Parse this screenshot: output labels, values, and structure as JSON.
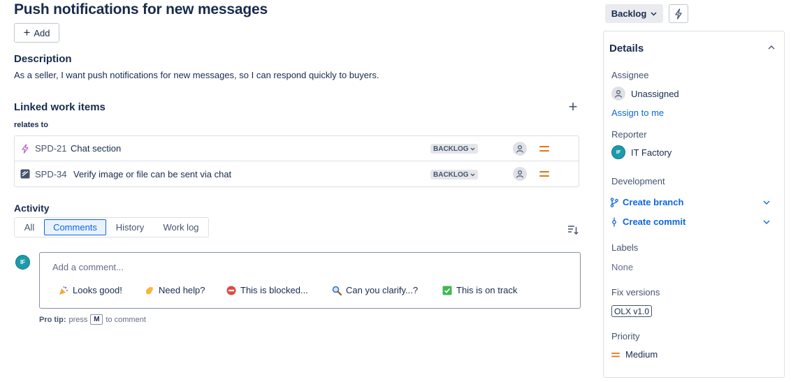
{
  "issue": {
    "title": "Push notifications for new messages",
    "add_label": "Add"
  },
  "description": {
    "heading": "Description",
    "text": "As a seller, I want push notifications for new messages, so I can respond quickly to buyers."
  },
  "linked": {
    "heading": "Linked work items",
    "relation": "relates to",
    "items": [
      {
        "key": "SPD-21",
        "summary": "Chat section",
        "status": "BACKLOG",
        "type_icon": "subtask-lightning-icon",
        "priority": "medium"
      },
      {
        "key": "SPD-34",
        "summary": "Verify image or file can be sent via chat",
        "status": "BACKLOG",
        "type_icon": "story-icon",
        "priority": "medium"
      }
    ]
  },
  "activity": {
    "heading": "Activity",
    "tabs": [
      "All",
      "Comments",
      "History",
      "Work log"
    ],
    "active_tab": "Comments",
    "avatar_initials": "IF",
    "comment_placeholder": "Add a comment...",
    "quick_replies": [
      {
        "emoji": "party-popper-icon",
        "label": "Looks good!"
      },
      {
        "emoji": "waving-hand-icon",
        "label": "Need help?"
      },
      {
        "emoji": "no-entry-icon",
        "label": "This is blocked..."
      },
      {
        "emoji": "magnifier-icon",
        "label": "Can you clarify...?"
      },
      {
        "emoji": "check-mark-icon",
        "label": "This is on track"
      }
    ],
    "pro_tip_label": "Pro tip:",
    "pro_tip_pre": "press",
    "pro_tip_key": "M",
    "pro_tip_post": "to comment"
  },
  "status_button": "Backlog",
  "details": {
    "heading": "Details",
    "assignee_label": "Assignee",
    "assignee_value": "Unassigned",
    "assign_to_me": "Assign to me",
    "reporter_label": "Reporter",
    "reporter_initials": "IF",
    "reporter_value": "IT Factory",
    "development_label": "Development",
    "create_branch": "Create branch",
    "create_commit": "Create commit",
    "labels_label": "Labels",
    "labels_value": "None",
    "fix_versions_label": "Fix versions",
    "fix_version": "OLX v1.0",
    "priority_label": "Priority",
    "priority_value": "Medium"
  },
  "colors": {
    "link": "#0c66e4",
    "priority_medium": "#e2740d",
    "avatar_teal": "#1d9aaa",
    "text": "#172b4d"
  }
}
